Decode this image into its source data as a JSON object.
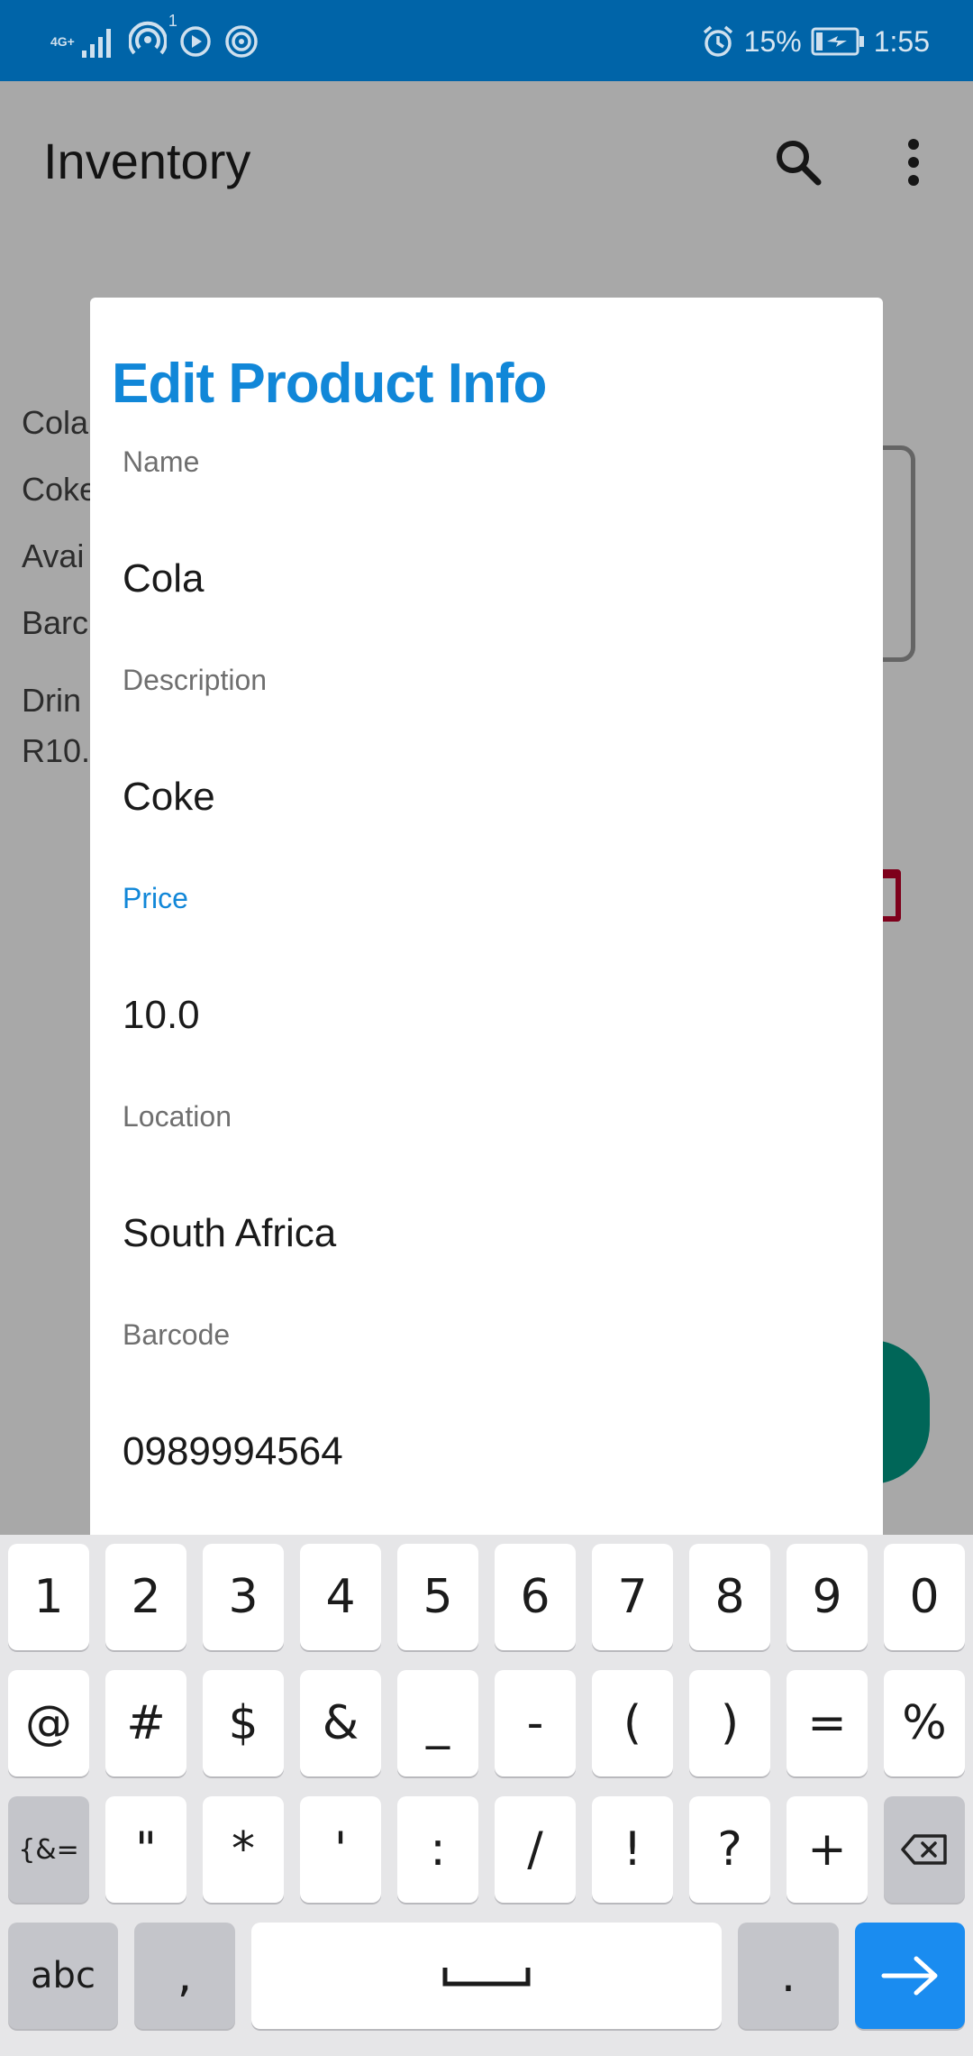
{
  "status_bar": {
    "network_type": "4G+",
    "notification_count": "1",
    "battery_percent": "15%",
    "time": "1:55",
    "icons": [
      "signal-icon",
      "hotspot-icon",
      "play-icon",
      "nfc-icon",
      "alarm-icon",
      "battery-charging-icon"
    ]
  },
  "toolbar": {
    "title": "Inventory",
    "icons": [
      "search-icon",
      "more-vert-icon"
    ]
  },
  "background_product": {
    "lines": [
      "Cola",
      "Coke",
      "Avai",
      "Barc",
      "Drin",
      "R10."
    ]
  },
  "dialog": {
    "title": "Edit Product Info",
    "fields": [
      {
        "label": "Name",
        "value": "Cola",
        "focused": false
      },
      {
        "label": "Description",
        "value": "Coke",
        "focused": false
      },
      {
        "label": "Price",
        "value": "10.0",
        "focused": true
      },
      {
        "label": "Location",
        "value": "South Africa",
        "focused": false
      },
      {
        "label": "Barcode",
        "value": "0989994564",
        "focused": false
      }
    ]
  },
  "keyboard": {
    "row1": [
      "1",
      "2",
      "3",
      "4",
      "5",
      "6",
      "7",
      "8",
      "9",
      "0"
    ],
    "row2": [
      "@",
      "#",
      "$",
      "&",
      "_",
      "-",
      "(",
      ")",
      "=",
      "%"
    ],
    "row3": [
      "{&=",
      "\"",
      "*",
      "'",
      ":",
      "/",
      "!",
      "?",
      "+"
    ],
    "row4": {
      "abc": "abc",
      "comma": ",",
      "period": "."
    },
    "icons": [
      "backspace-icon",
      "space-icon",
      "enter-arrow-icon"
    ],
    "accent_color": "#1a8cf0"
  },
  "colors": {
    "status_bar": "#0064a8",
    "title_accent": "#1187d8",
    "fab": "#009b86",
    "delete_icon": "#c0002a"
  }
}
